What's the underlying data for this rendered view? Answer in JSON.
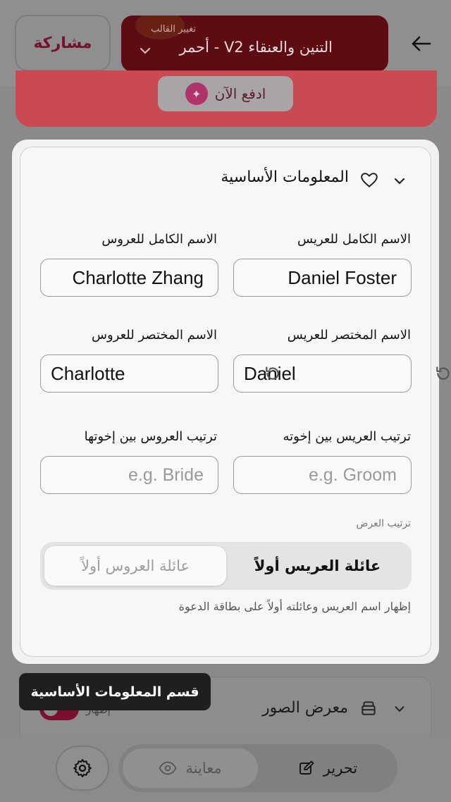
{
  "header": {
    "share_label": "مشاركة",
    "template_small_label": "تغيير القالب",
    "template_name": "التنين والعنقاء V2 - أحمر"
  },
  "banner": {
    "button_label": "ادفع الآن"
  },
  "basic_info": {
    "title": "المعلومات الأساسية",
    "groom_full_name": {
      "label": "الاسم الكامل للعريس",
      "value": "Daniel Foster"
    },
    "bride_full_name": {
      "label": "الاسم الكامل للعروس",
      "value": "Charlotte Zhang"
    },
    "groom_short_name": {
      "label": "الاسم المختصر للعريس",
      "value": "Daniel"
    },
    "bride_short_name": {
      "label": "الاسم المختصر للعروس",
      "value": "Charlotte"
    },
    "groom_sibling_order": {
      "label": "ترتيب العريس بين إخوته",
      "placeholder": "e.g. Groom"
    },
    "bride_sibling_order": {
      "label": "ترتيب العروس بين إخوتها",
      "placeholder": "e.g. Bride"
    },
    "display_order": {
      "label": "ترتيب العرض",
      "options": [
        "عائلة العريس أولاً",
        "عائلة العروس أولاً"
      ],
      "selected": "عائلة العريس أولاً"
    },
    "helper_text": "إظهار اسم العريس وعائلته أولاً على بطاقة الدعوة"
  },
  "gallery": {
    "title": "معرض الصور",
    "toggle_label": "إظهار",
    "enabled": true
  },
  "tooltip": "قسم المعلومات الأساسية",
  "bottom_nav": {
    "edit_label": "تحرير",
    "preview_label": "معاينة",
    "active": "edit"
  },
  "colors": {
    "accent": "#7a1030",
    "banner": "#c94a52",
    "template_bg": "#5c0c12"
  }
}
